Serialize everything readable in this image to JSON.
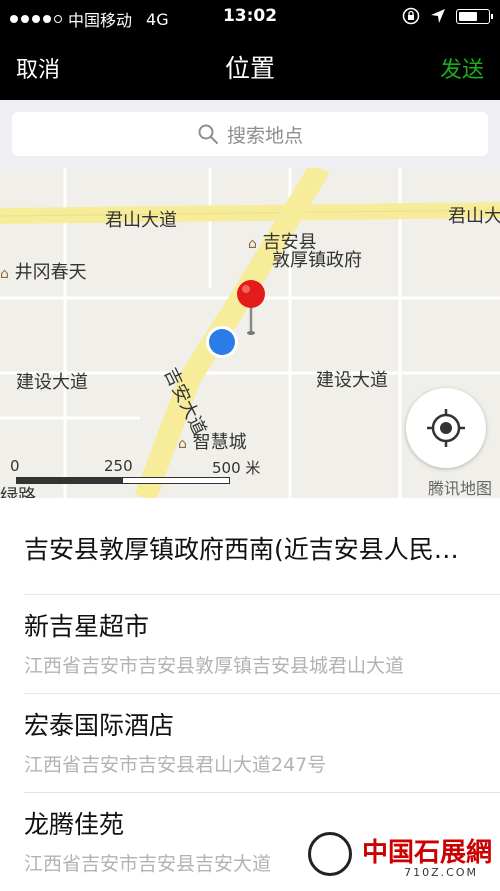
{
  "status_bar": {
    "carrier": "中国移动",
    "network": "4G",
    "time": "13:02"
  },
  "nav": {
    "cancel_label": "取消",
    "title": "位置",
    "send_label": "发送",
    "send_color": "#1aad19"
  },
  "search": {
    "placeholder": "搜索地点"
  },
  "map": {
    "road_labels": [
      "君山大道",
      "君山大",
      "吉安大道",
      "建设大道",
      "建设大道",
      "绿路"
    ],
    "poi_labels": [
      "吉安县",
      "敦厚镇政府",
      "井冈春天",
      "智慧城"
    ],
    "scale_ticks": [
      "0",
      "250",
      "500 米"
    ],
    "provider": "腾讯地图",
    "current_location_color": "#2b7ce9",
    "pin_color": "#e31b1b",
    "road_color": "#f7ec9a"
  },
  "results": [
    {
      "name": "吉安县敦厚镇政府西南(近吉安县人民政府)",
      "address": ""
    },
    {
      "name": "新吉星超市",
      "address": "江西省吉安市吉安县敦厚镇吉安县城君山大道"
    },
    {
      "name": "宏泰国际酒店",
      "address": "江西省吉安市吉安县君山大道247号"
    },
    {
      "name": "龙腾佳苑",
      "address": "江西省吉安市吉安县吉安大道"
    }
  ],
  "watermark": {
    "brand": "中国石展網",
    "url": "710Z.COM"
  }
}
